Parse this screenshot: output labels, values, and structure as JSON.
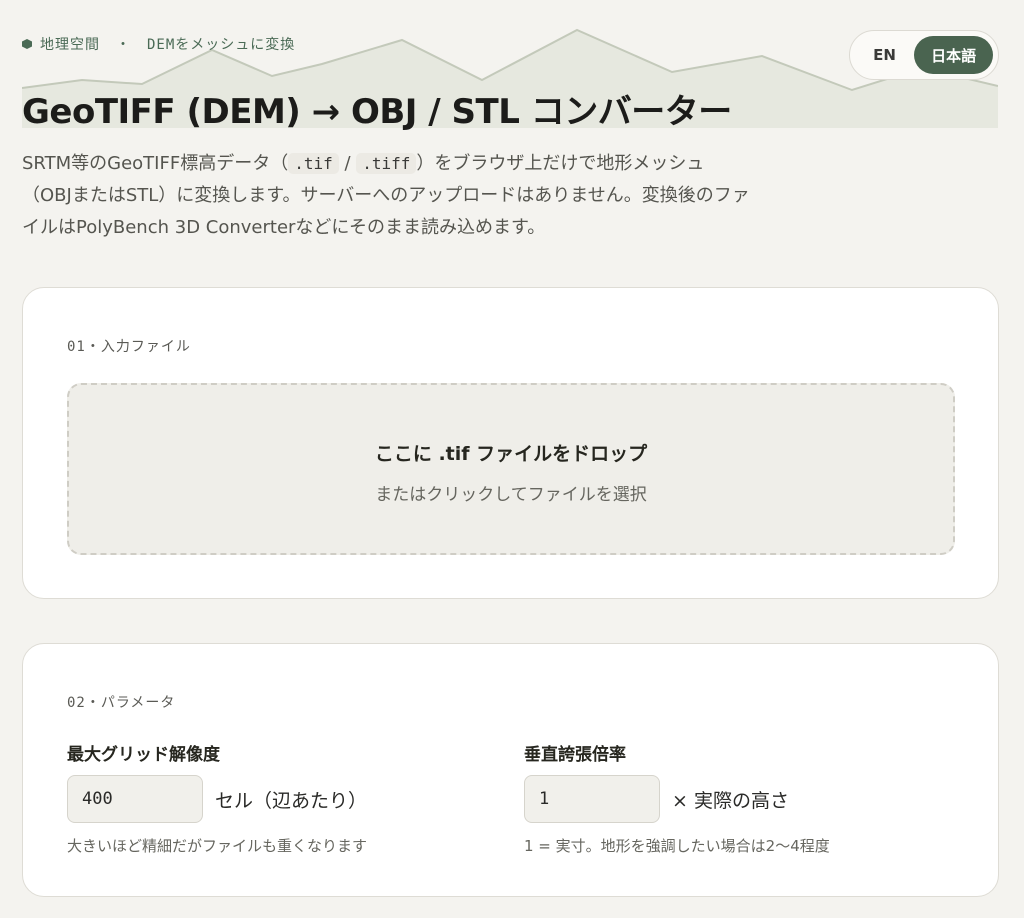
{
  "header": {
    "eyebrow_part1": "地理空間",
    "eyebrow_sep": "・",
    "eyebrow_part2": "DEMをメッシュに変換",
    "title": "GeoTIFF (DEM) → OBJ / STL コンバーター",
    "lang": {
      "en_label": "EN",
      "ja_label": "日本語",
      "active": "ja"
    }
  },
  "intro": {
    "text1": "SRTM等のGeoTIFF標高データ（",
    "code1": ".tif",
    "slash": " / ",
    "code2": ".tiff",
    "text2": "）をブラウザ上だけで地形メッシュ（OBJまたはSTL）に変換します。サーバーへのアップロードはありません。変換後のファイルはPolyBench 3D Converterなどにそのまま読み込めます。"
  },
  "input_section": {
    "label": "01・入力ファイル",
    "drop_title": "ここに .tif ファイルをドロップ",
    "drop_sub": "またはクリックしてファイルを選択"
  },
  "params_section": {
    "label": "02・パラメータ",
    "grid": {
      "label": "最大グリッド解像度",
      "value": "400",
      "unit": "セル（辺あたり）",
      "help": "大きいほど精細だがファイルも重くなります"
    },
    "vertical": {
      "label": "垂直誇張倍率",
      "value": "1",
      "unit": "× 実際の高さ",
      "help": "1 = 実寸。地形を強調したい場合は2〜4程度"
    }
  },
  "colors": {
    "accent": "#4a6450",
    "background": "#f4f3ef",
    "card": "#ffffff"
  }
}
